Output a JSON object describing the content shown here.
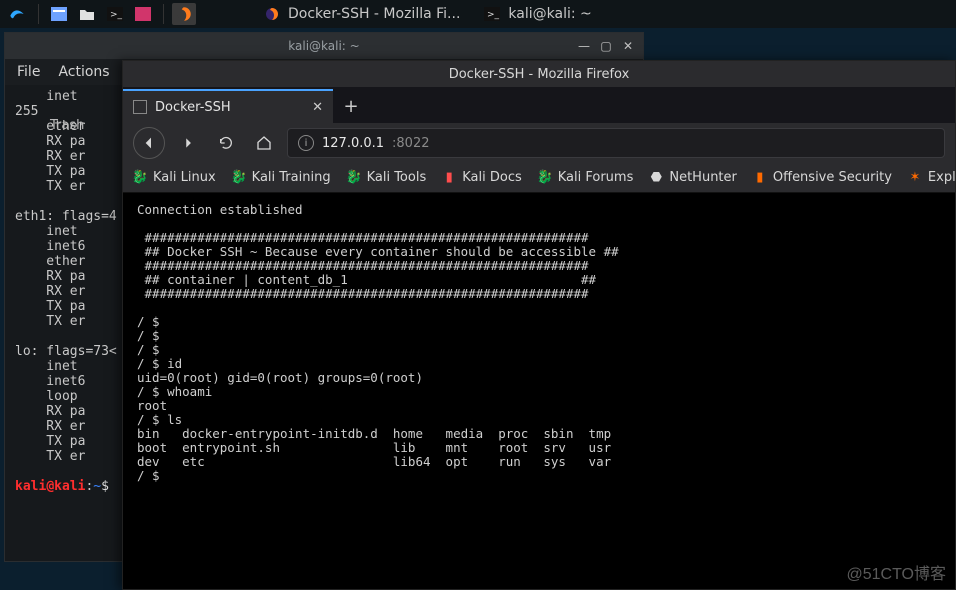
{
  "taskbar": {
    "entries": [
      {
        "label": "Docker-SSH - Mozilla Fi..."
      },
      {
        "label": "kali@kali: ~"
      }
    ]
  },
  "terminal_window": {
    "title": "kali@kali: ~",
    "menubar": {
      "file": "File",
      "actions": "Actions"
    },
    "body_lines": "    inet\n255\n    ether\n    RX pa\n    RX er\n    TX pa\n    TX er\n\neth1: flags=4\n    inet\n    inet6\n    ether\n    RX pa\n    RX er\n    TX pa\n    TX er\n\nlo: flags=73<\n    inet\n    inet6\n    loop\n    RX pa\n    RX er\n    TX pa\n    TX er",
    "prompt": {
      "user": "kali",
      "host": "kali",
      "cwd": "~",
      "symbol": "$"
    }
  },
  "trash_label": "Trash",
  "firefox": {
    "title": "Docker-SSH - Mozilla Firefox",
    "tab_label": "Docker-SSH",
    "new_tab_tooltip": "+",
    "url": {
      "host": "127.0.0.1",
      "port": ":8022"
    },
    "bookmarks": [
      "Kali Linux",
      "Kali Training",
      "Kali Tools",
      "Kali Docs",
      "Kali Forums",
      "NetHunter",
      "Offensive Security",
      "Exploi"
    ],
    "page_content": "Connection established\n\n ###########################################################\n ## Docker SSH ~ Because every container should be accessible ##\n ###########################################################\n ## container | content_db_1                               ##\n ###########################################################\n\n/ $\n/ $\n/ $\n/ $ id\nuid=0(root) gid=0(root) groups=0(root)\n/ $ whoami\nroot\n/ $ ls\nbin   docker-entrypoint-initdb.d  home   media  proc  sbin  tmp\nboot  entrypoint.sh               lib    mnt    root  srv   usr\ndev   etc                         lib64  opt    run   sys   var\n/ $"
  },
  "watermark": "@51CTO博客"
}
